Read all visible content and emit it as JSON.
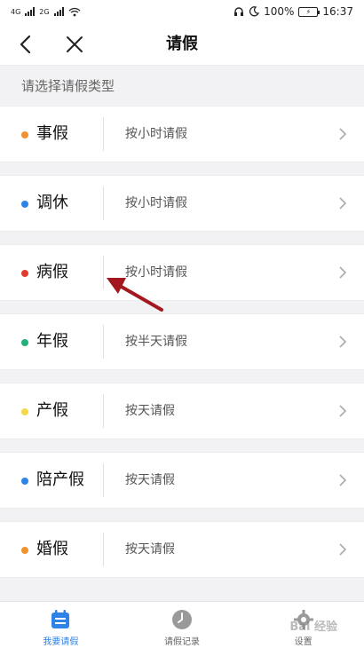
{
  "status_bar": {
    "net1": "4G",
    "net2": "2G",
    "battery": "100%",
    "time": "16:37"
  },
  "nav": {
    "title": "请假"
  },
  "section_header": "请选择请假类型",
  "leave_types": [
    {
      "name": "事假",
      "unit": "按小时请假",
      "color": "#f0922e"
    },
    {
      "name": "调休",
      "unit": "按小时请假",
      "color": "#2e83e6"
    },
    {
      "name": "病假",
      "unit": "按小时请假",
      "color": "#e23b2e"
    },
    {
      "name": "年假",
      "unit": "按半天请假",
      "color": "#22b07a"
    },
    {
      "name": "产假",
      "unit": "按天请假",
      "color": "#f5d84a"
    },
    {
      "name": "陪产假",
      "unit": "按天请假",
      "color": "#2e83e6"
    },
    {
      "name": "婚假",
      "unit": "按天请假",
      "color": "#f0922e"
    }
  ],
  "tabs": [
    {
      "label": "我要请假",
      "icon": "calendar-icon",
      "active": true
    },
    {
      "label": "请假记录",
      "icon": "clock-icon",
      "active": false
    },
    {
      "label": "设置",
      "icon": "gear-icon",
      "active": false
    }
  ],
  "accent_color": "#2e83e6",
  "annotation_color": "#a3181f",
  "watermark": "Bai 经验"
}
